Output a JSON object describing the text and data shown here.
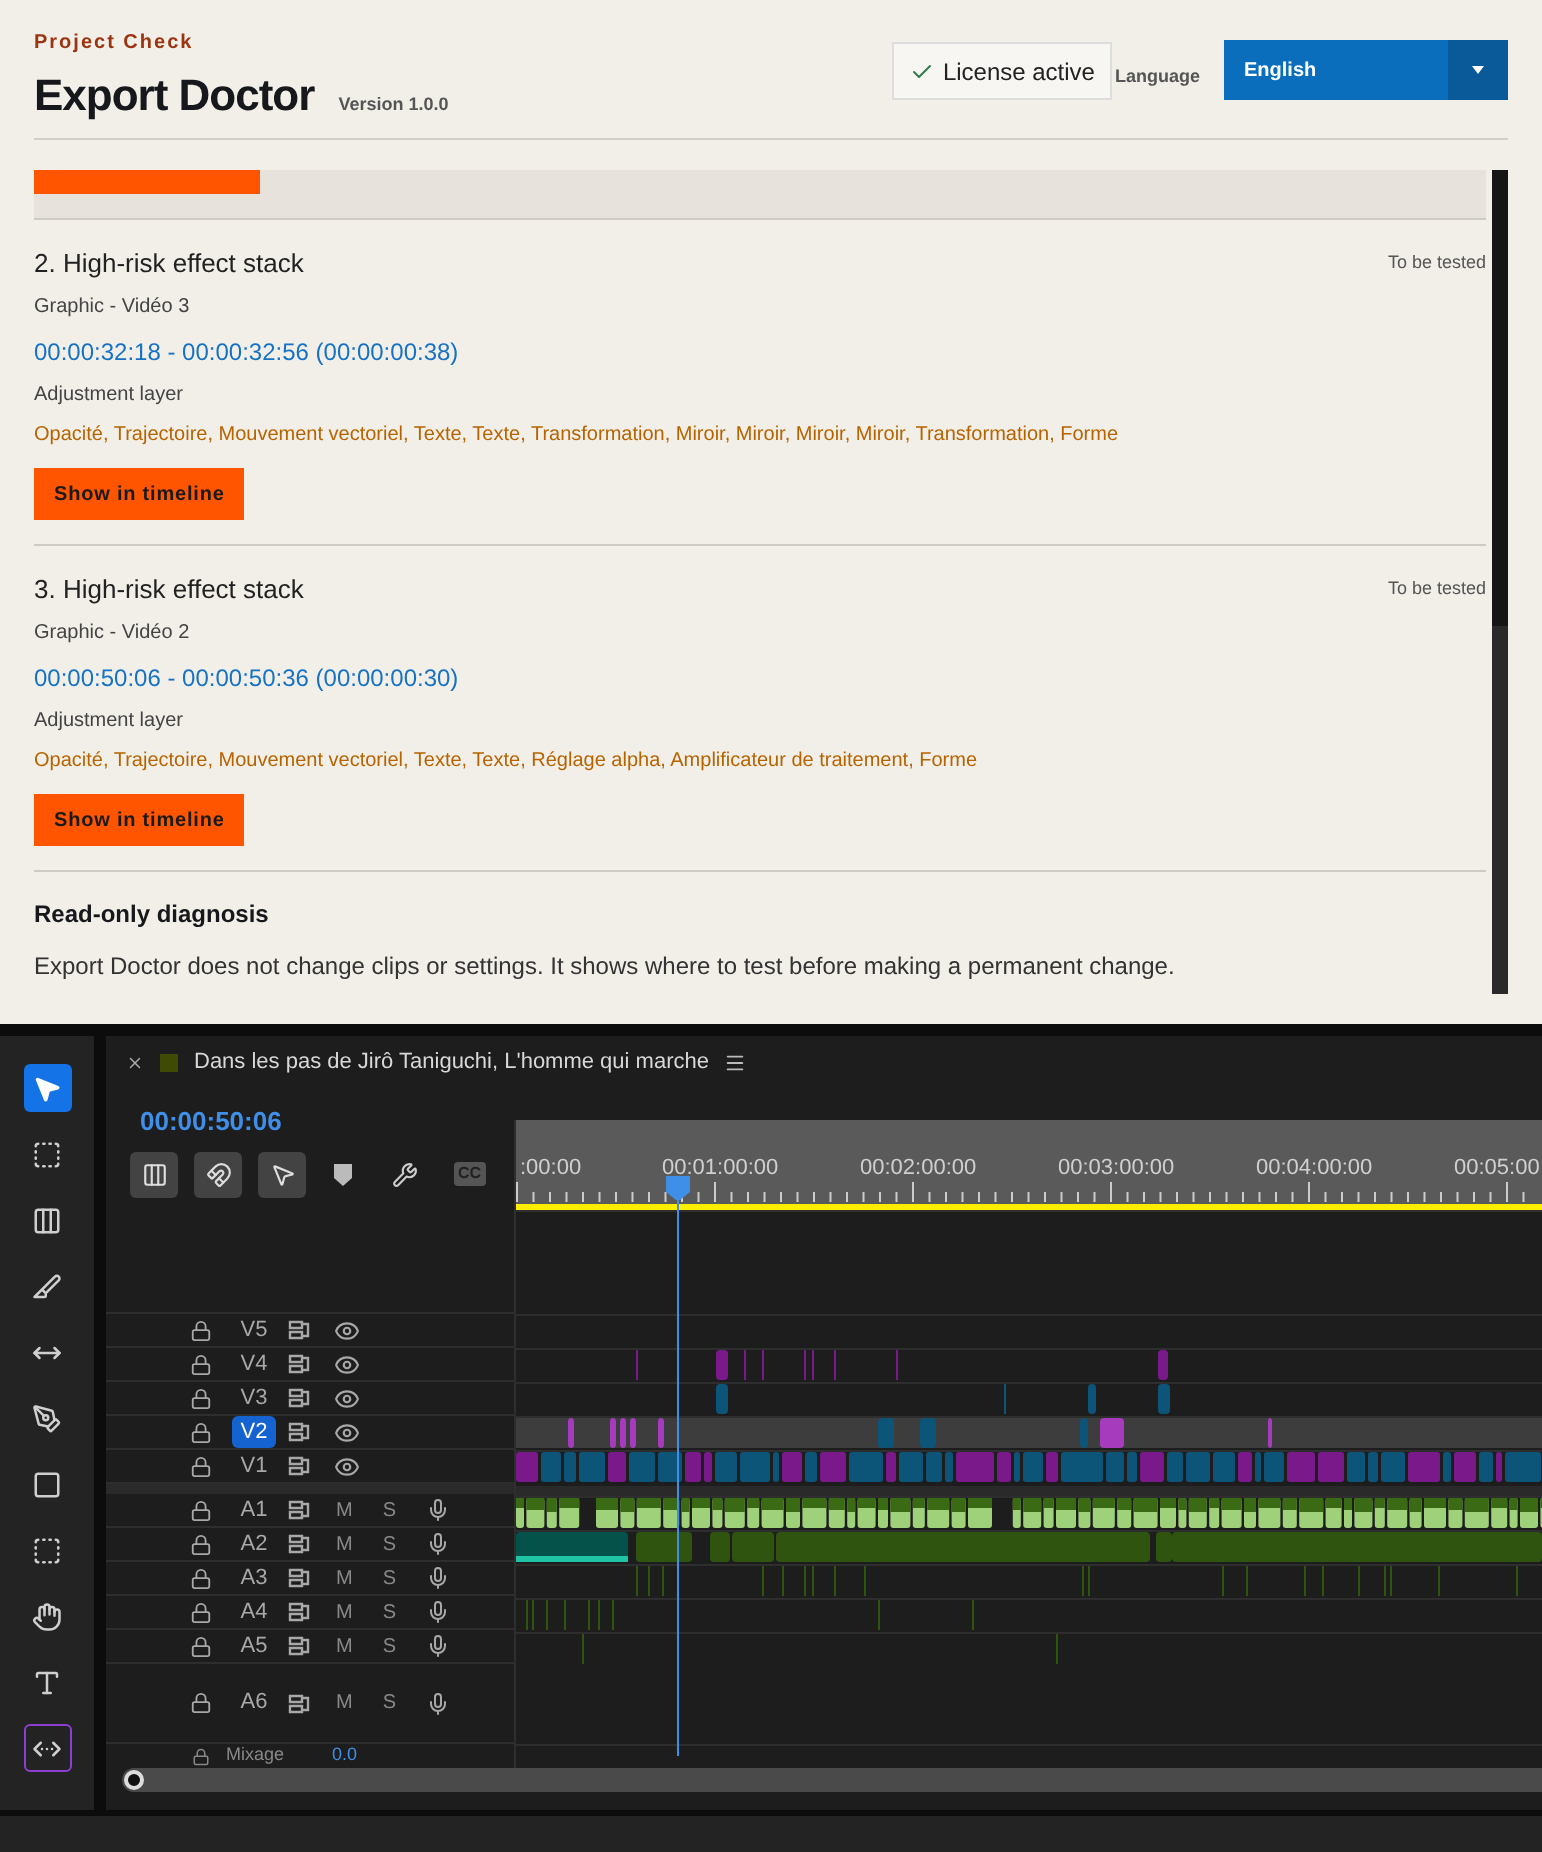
{
  "header": {
    "eyebrow": "Project Check",
    "title": "Export Doctor",
    "version": "Version 1.0.0",
    "license": "License active",
    "language_label": "Language",
    "language_value": "English"
  },
  "issues": [
    {
      "title": "2. High-risk effect stack",
      "status": "To be tested",
      "source": "Graphic - Vidéo 3",
      "timecode": "00:00:32:18 - 00:00:32:56 (00:00:00:38)",
      "layer": "Adjustment layer",
      "effects": "Opacité, Trajectoire, Mouvement vectoriel, Texte, Texte, Transformation, Miroir, Miroir, Miroir, Miroir, Transformation, Forme",
      "button": "Show in timeline"
    },
    {
      "title": "3. High-risk effect stack",
      "status": "To be tested",
      "source": "Graphic - Vidéo 2",
      "timecode": "00:00:50:06 - 00:00:50:36 (00:00:00:30)",
      "layer": "Adjustment layer",
      "effects": "Opacité, Trajectoire, Mouvement vectoriel, Texte, Texte, Réglage alpha, Amplificateur de traitement, Forme",
      "button": "Show in timeline"
    }
  ],
  "diagnosis": {
    "title": "Read-only diagnosis",
    "text": "Export Doctor does not change clips or settings. It shows where to test before making a permanent change."
  },
  "tools": [
    {
      "kind": "select",
      "selected": true,
      "outlined": false
    },
    {
      "kind": "track",
      "selected": false,
      "outlined": false
    },
    {
      "kind": "ripple",
      "selected": false,
      "outlined": false
    },
    {
      "kind": "razor",
      "selected": false,
      "outlined": false
    },
    {
      "kind": "slip",
      "selected": false,
      "outlined": false
    },
    {
      "kind": "pen",
      "selected": false,
      "outlined": false
    },
    {
      "kind": "rect",
      "selected": false,
      "outlined": false
    },
    {
      "kind": "marquee",
      "selected": false,
      "outlined": false
    },
    {
      "kind": "hand",
      "selected": false,
      "outlined": false
    },
    {
      "kind": "text",
      "selected": false,
      "outlined": false
    },
    {
      "kind": "remix",
      "selected": false,
      "outlined": true
    }
  ],
  "sequence": {
    "title": "Dans les pas de Jirô Taniguchi, L'homme qui marche",
    "timecode": "00:00:50:06",
    "cc": "CC"
  },
  "ruler": [
    ":00:00",
    "00:01:00:00",
    "00:02:00:00",
    "00:03:00:00",
    "00:04:00:00",
    "00:05:00"
  ],
  "tracks": [
    {
      "label": "V5",
      "kind": "video",
      "selected": false
    },
    {
      "label": "V4",
      "kind": "video",
      "selected": false
    },
    {
      "label": "V3",
      "kind": "video",
      "selected": false
    },
    {
      "label": "V2",
      "kind": "video",
      "selected": true
    },
    {
      "label": "V1",
      "kind": "video",
      "selected": false
    },
    {
      "label": "A1",
      "kind": "audio",
      "selected": false,
      "mute": "M",
      "solo": "S"
    },
    {
      "label": "A2",
      "kind": "audio",
      "selected": false,
      "mute": "M",
      "solo": "S"
    },
    {
      "label": "A3",
      "kind": "audio",
      "selected": false,
      "mute": "M",
      "solo": "S"
    },
    {
      "label": "A4",
      "kind": "audio",
      "selected": false,
      "mute": "M",
      "solo": "S"
    },
    {
      "label": "A5",
      "kind": "audio",
      "selected": false,
      "mute": "M",
      "solo": "S"
    },
    {
      "label": "A6",
      "kind": "audio",
      "selected": false,
      "mute": "M",
      "solo": "S"
    }
  ],
  "mix": {
    "label": "Mixage",
    "value": "0.0"
  }
}
